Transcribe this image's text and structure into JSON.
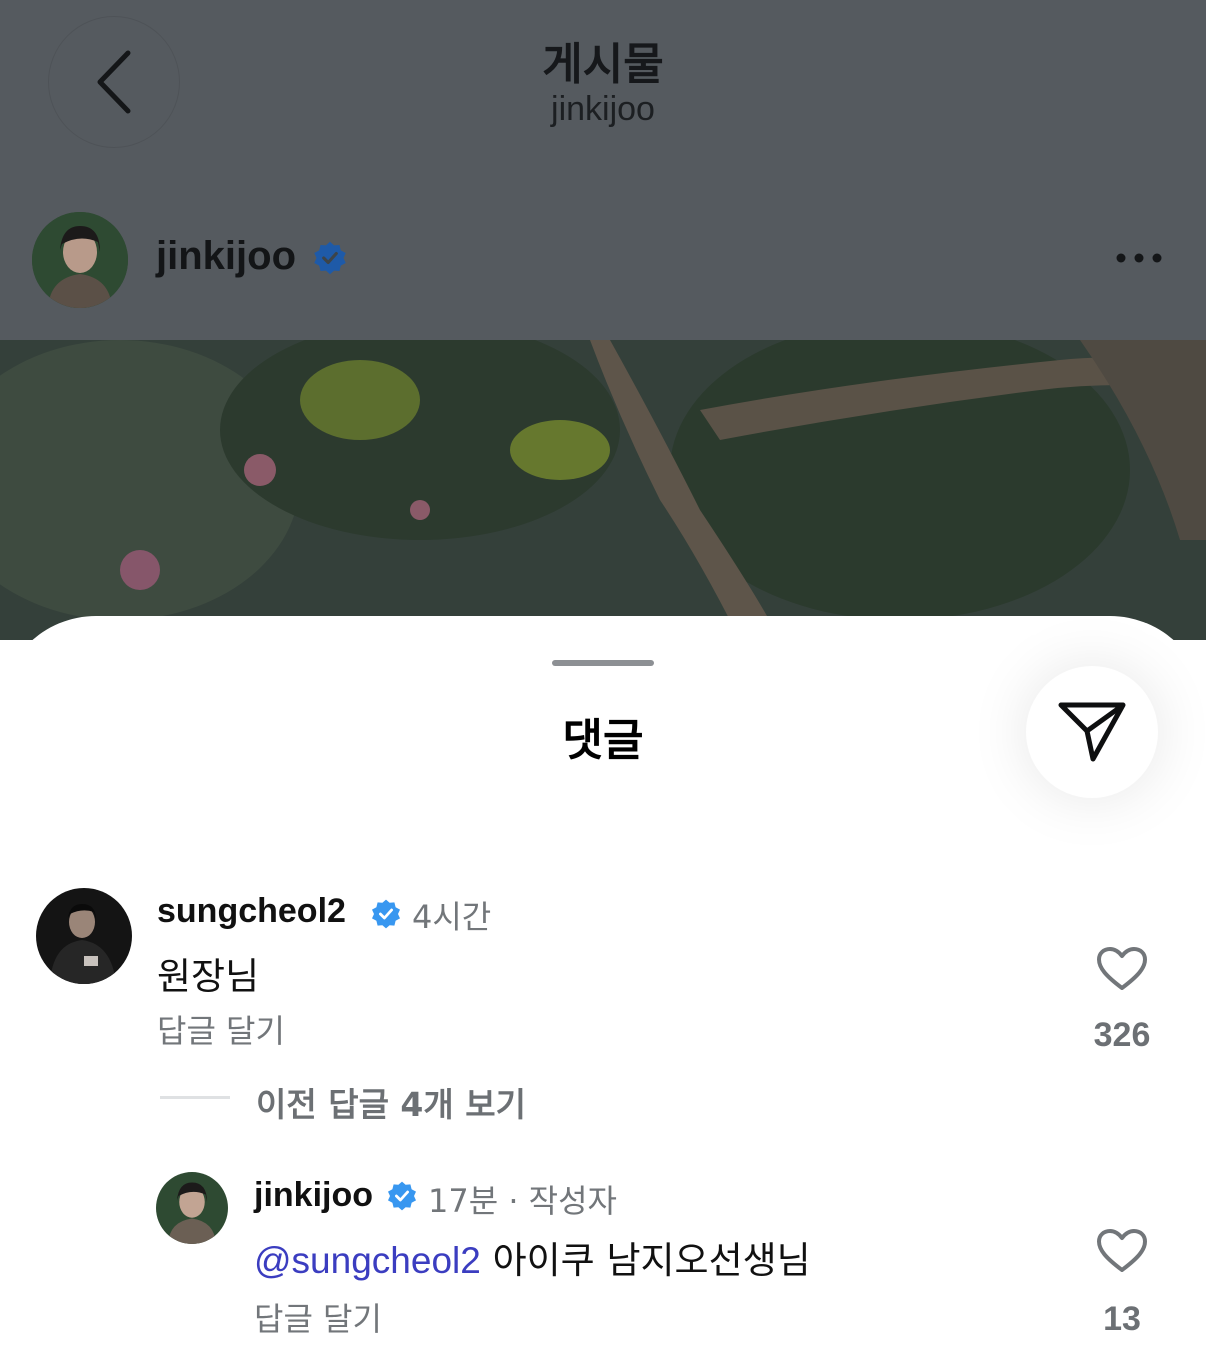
{
  "header": {
    "title": "게시물",
    "subtitle": "jinkijoo",
    "back_icon": "chevron-left-icon"
  },
  "author": {
    "username": "jinkijoo",
    "verified": true,
    "more_icon": "more-horizontal-icon"
  },
  "comments_sheet": {
    "title": "댓글",
    "share_icon": "send-icon"
  },
  "comments": [
    {
      "username": "sungcheol2",
      "verified": true,
      "time": "4시간",
      "text": "원장님",
      "reply_label": "답글 달기",
      "like_count": "326"
    }
  ],
  "view_previous_replies": "이전 답글 4개 보기",
  "replies": [
    {
      "username": "jinkijoo",
      "verified": true,
      "time": "17분 · 작성자",
      "mention": "@sungcheol2",
      "text": " 아이쿠 남지오선생님",
      "reply_label": "답글 달기",
      "like_count": "13"
    }
  ],
  "colors": {
    "verified_blue": "#3897f0",
    "mention_blue": "#3b3dc0",
    "secondary_text": "#72767a",
    "dim_overlay": "#555a5f"
  }
}
